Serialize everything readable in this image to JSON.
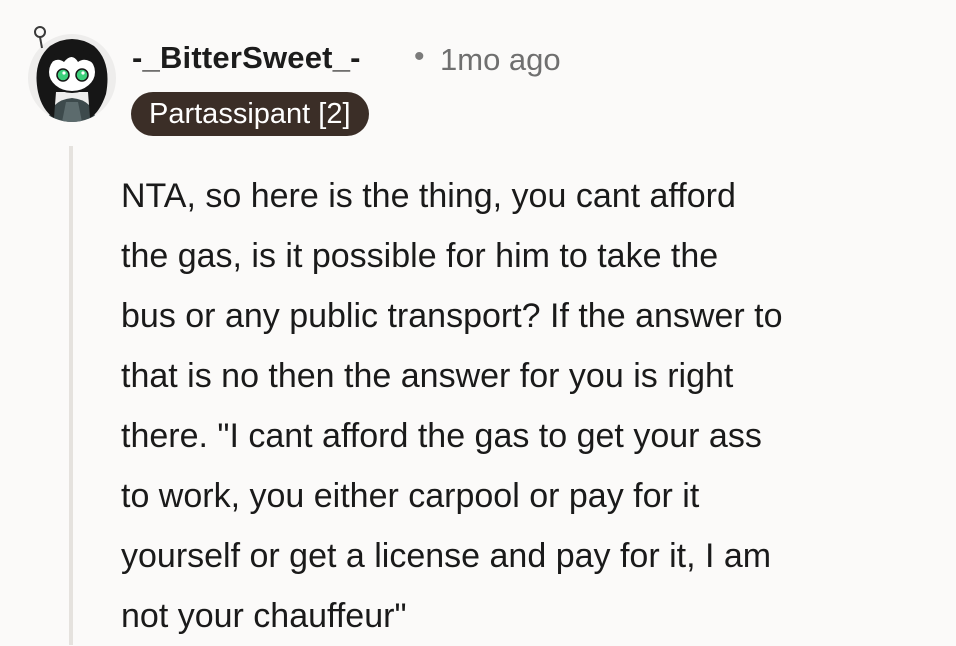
{
  "comment": {
    "author": "-_BitterSweet_-",
    "separator": "•",
    "timestamp": "1mo ago",
    "flair": "Partassipant [2]",
    "body_lines": [
      "NTA, so here is the thing, you cant afford",
      "the gas, is it possible for him to take the",
      "bus or any public transport? If the answer to",
      "that is no then the answer for you is right",
      "there. \"I cant afford the gas to get your ass",
      "to work, you either carpool or pay for it",
      "yourself or get a license and pay for it, I am",
      "not your chauffeur\""
    ]
  },
  "colors": {
    "background": "#fbfaf9",
    "flair_bg": "#3b2e27",
    "flair_text": "#ffffff",
    "thread_line": "#e5e2de",
    "avatar_eyes": "#3ccf7a"
  },
  "icons": {
    "avatar": "user-avatar-snoo"
  }
}
